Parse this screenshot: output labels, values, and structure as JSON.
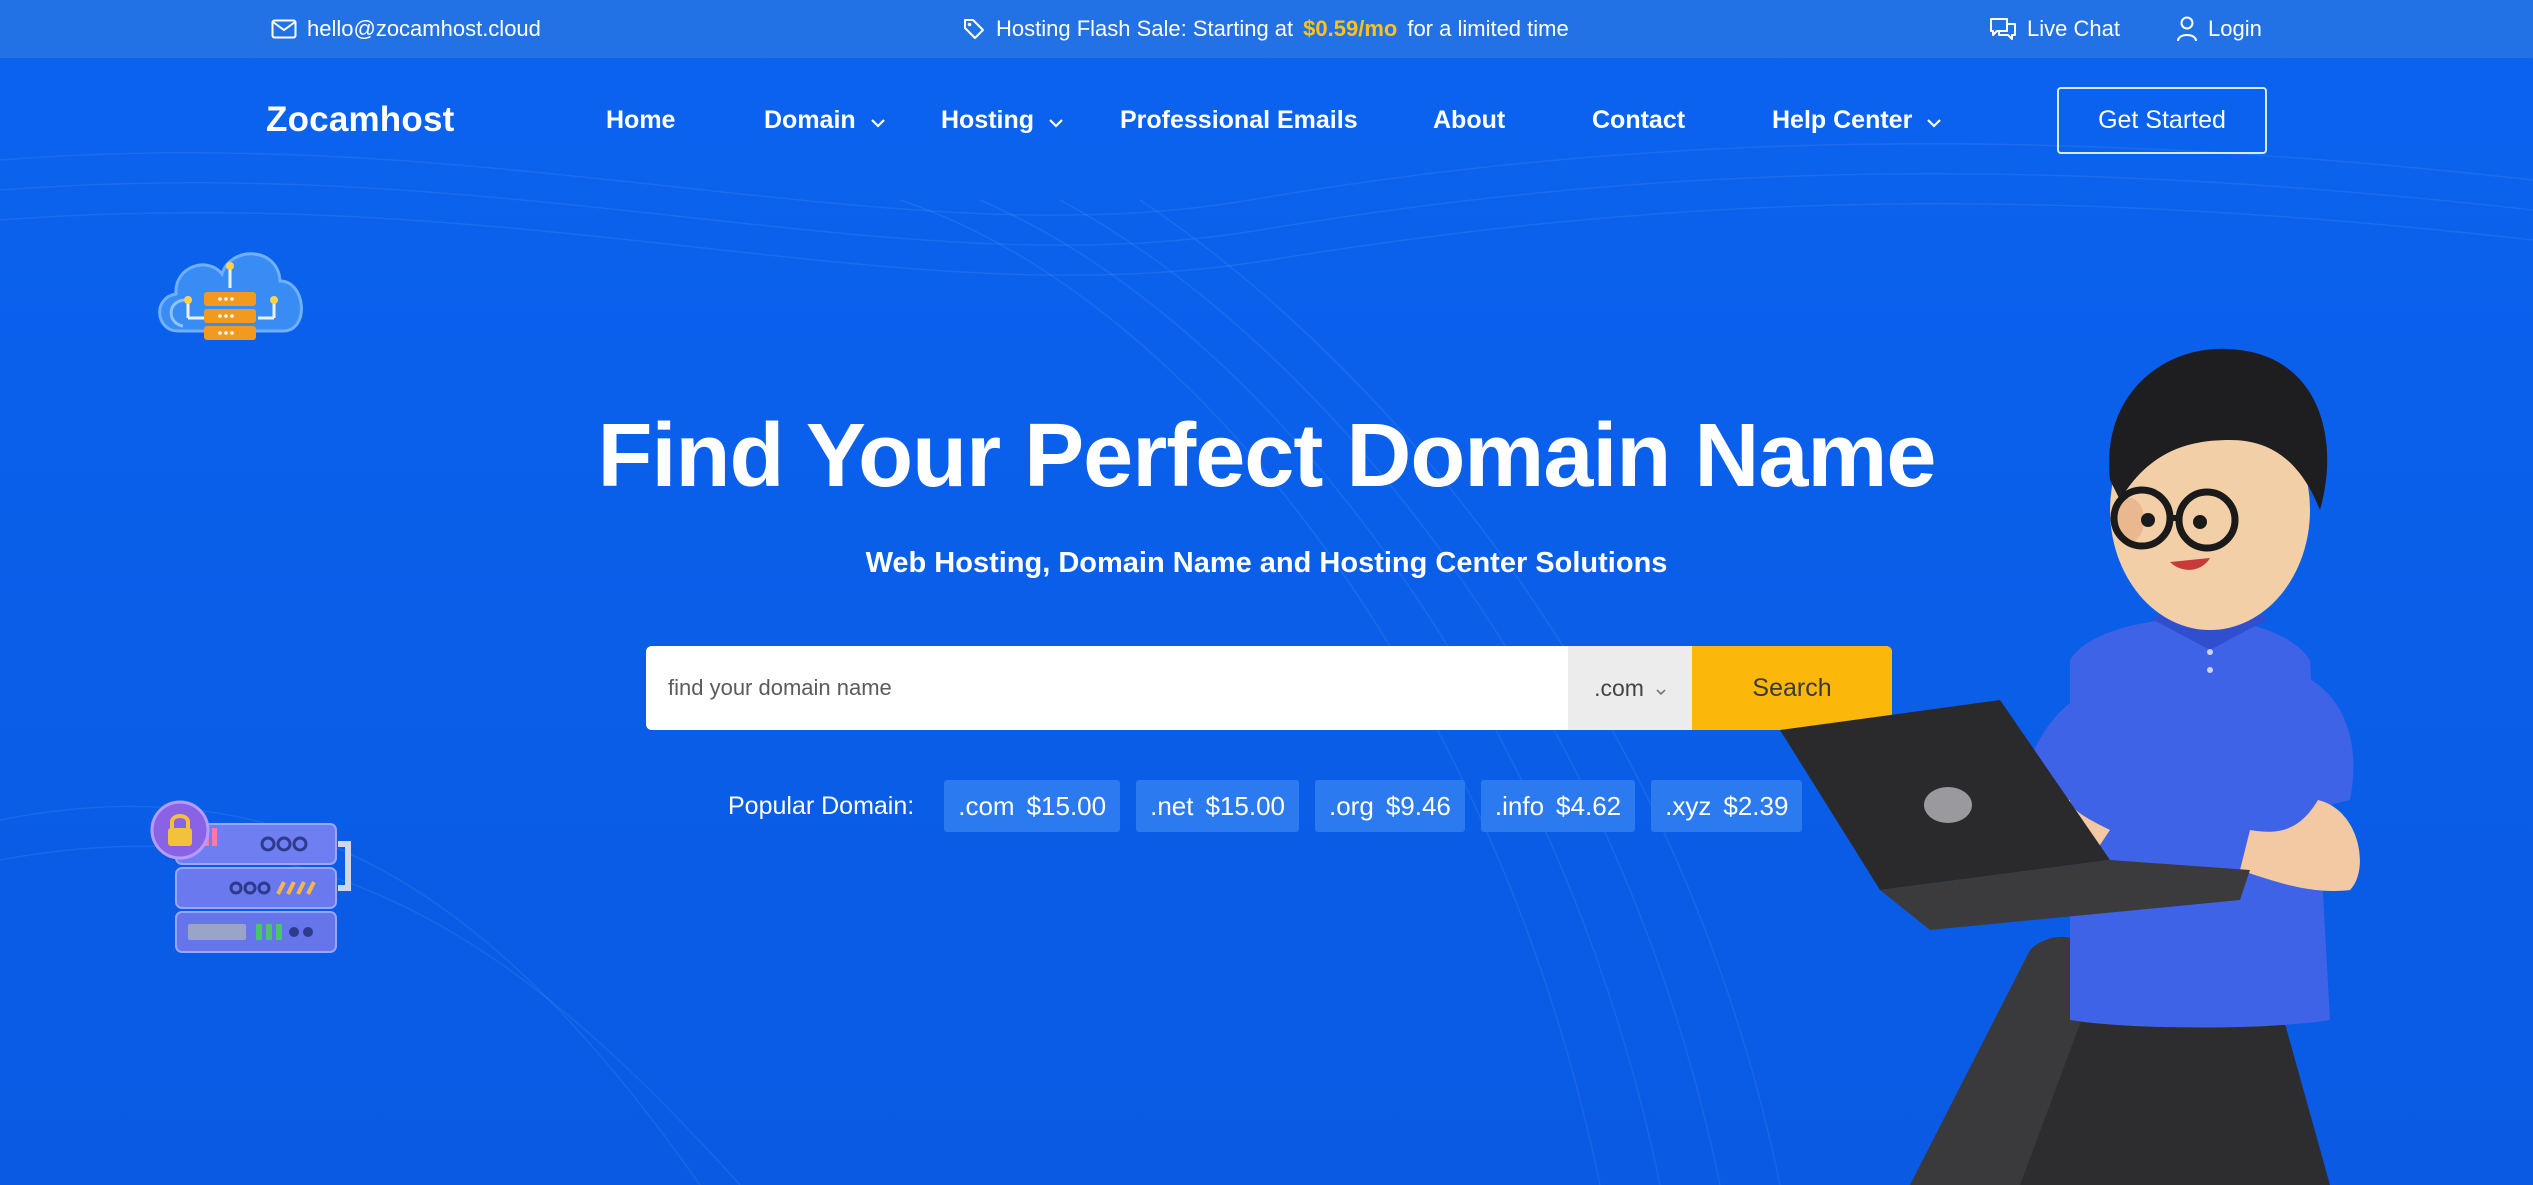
{
  "topbar": {
    "email": "hello@zocamhost.cloud",
    "promo_prefix": "Hosting Flash Sale: Starting at",
    "promo_price": "$0.59/mo",
    "promo_suffix": "for a limited time",
    "live_chat": "Live Chat",
    "login": "Login"
  },
  "nav": {
    "brand": "Zocamhost",
    "items": [
      {
        "label": "Home"
      },
      {
        "label": "Domain"
      },
      {
        "label": "Hosting"
      },
      {
        "label": "Professional Emails"
      },
      {
        "label": "About"
      },
      {
        "label": "Contact"
      },
      {
        "label": "Help Center"
      }
    ],
    "cta": "Get Started"
  },
  "hero": {
    "title": "Find Your Perfect Domain Name",
    "subtitle": "Web Hosting, Domain Name and Hosting Center Solutions"
  },
  "search": {
    "placeholder": "find your domain name",
    "value": "",
    "tld": ".com",
    "button": "Search"
  },
  "popular": {
    "label": "Popular Domain:",
    "domains": [
      {
        "tld": ".com",
        "price": "$15.00"
      },
      {
        "tld": ".net",
        "price": "$15.00"
      },
      {
        "tld": ".org",
        "price": "$9.46"
      },
      {
        "tld": ".info",
        "price": "$4.62"
      },
      {
        "tld": ".xyz",
        "price": "$2.39"
      }
    ]
  },
  "icons": {
    "email": "mail-icon",
    "promo": "tag-icon",
    "chat": "chat-bubbles-icon",
    "login": "user-icon",
    "dropdown": "chevron-down-icon"
  },
  "colors": {
    "background": "#0b63ef",
    "topbar": "#2272e6",
    "accent": "#ffc21a",
    "search_button": "#fbb80a",
    "chip": "#2b7aef"
  }
}
